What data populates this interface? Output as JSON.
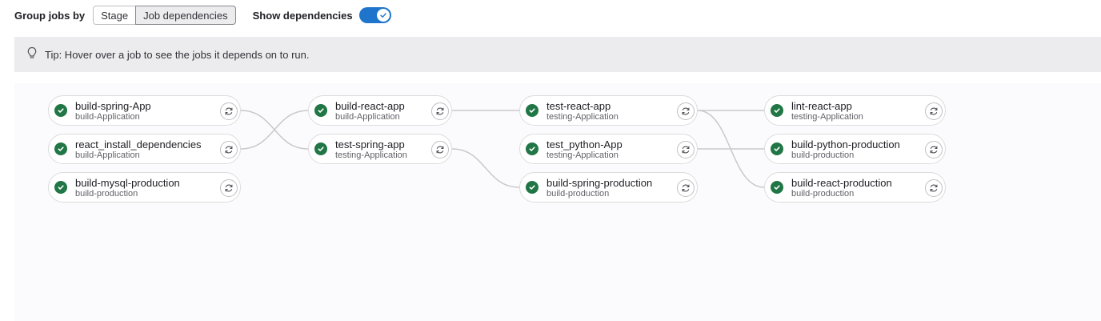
{
  "toolbar": {
    "group_label": "Group jobs by",
    "options": [
      "Stage",
      "Job dependencies"
    ],
    "selected": "Job dependencies",
    "show_dependencies_label": "Show dependencies",
    "show_dependencies_on": true
  },
  "tip": {
    "text": "Tip: Hover over a job to see the jobs it depends on to run."
  },
  "icons": {
    "status": "check-circle-icon",
    "retry": "retry-icon",
    "tip": "lightbulb-icon"
  },
  "colors": {
    "accent": "#1f75cb",
    "success": "#217645"
  },
  "columns": [
    {
      "jobs": [
        {
          "name": "build-spring-App",
          "stage": "build-Application"
        },
        {
          "name": "react_install_dependencies",
          "stage": "build-Application"
        },
        {
          "name": "build-mysql-production",
          "stage": "build-production"
        }
      ]
    },
    {
      "jobs": [
        {
          "name": "build-react-app",
          "stage": "build-Application"
        },
        {
          "name": "test-spring-app",
          "stage": "testing-Application"
        }
      ]
    },
    {
      "jobs": [
        {
          "name": "test-react-app",
          "stage": "testing-Application"
        },
        {
          "name": "test_python-App",
          "stage": "testing-Application"
        },
        {
          "name": "build-spring-production",
          "stage": "build-production"
        }
      ]
    },
    {
      "jobs": [
        {
          "name": "lint-react-app",
          "stage": "testing-Application"
        },
        {
          "name": "build-python-production",
          "stage": "build-production"
        },
        {
          "name": "build-react-production",
          "stage": "build-production"
        }
      ]
    }
  ]
}
